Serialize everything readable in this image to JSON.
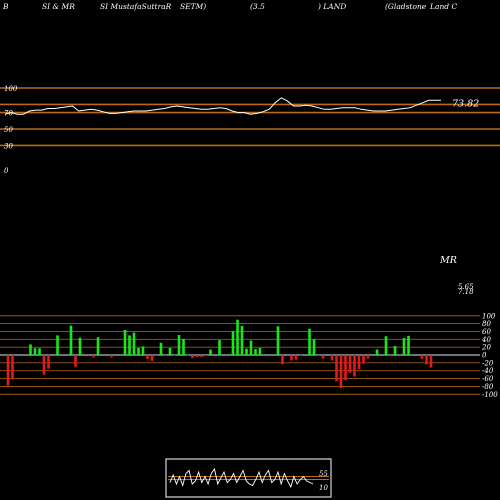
{
  "header": {
    "items": [
      "B",
      "SI & MR",
      "SI MustafaSuttraR",
      "SETM)",
      "(3.5",
      ") LAND",
      "(Gladstone",
      "Land C"
    ]
  },
  "colors": {
    "background": "#000000",
    "guide": "#b86a1a",
    "rsi_line": "#ffffff",
    "positive": "#19e619",
    "negative": "#e61919",
    "grid": "#ffffff"
  },
  "chart_data": [
    {
      "type": "line",
      "name": "RSI",
      "ylim": [
        0,
        100
      ],
      "ytick_labels": [
        "100",
        "70",
        "50",
        "30",
        "0"
      ],
      "guide_levels": [
        100,
        80,
        70,
        50,
        30
      ],
      "last_value_label": "73.82",
      "values": [
        68,
        70,
        68,
        68,
        72,
        73,
        73,
        75,
        75,
        76,
        77,
        78,
        72,
        73,
        74,
        73,
        71,
        69,
        69,
        70,
        71,
        72,
        72,
        72,
        73,
        74,
        75,
        77,
        78,
        77,
        76,
        75,
        74,
        74,
        75,
        76,
        75,
        72,
        70,
        70,
        68,
        69,
        71,
        74,
        82,
        88,
        84,
        78,
        78,
        79,
        78,
        76,
        74,
        74,
        75,
        76,
        76,
        76,
        74,
        73,
        72,
        72,
        72,
        73,
        74,
        75,
        76,
        79,
        82,
        85,
        85,
        85
      ]
    },
    {
      "type": "bar",
      "name": "MR",
      "title": "MR",
      "ylim": [
        -100,
        100
      ],
      "yticks": [
        100,
        80,
        60,
        40,
        20,
        0,
        -20,
        -40,
        -60,
        -80,
        -100
      ],
      "last_value_labels": [
        "5.65",
        "7.18"
      ],
      "values": [
        -78,
        -62,
        0,
        0,
        0,
        27,
        17,
        17,
        -50,
        -35,
        0,
        50,
        0,
        0,
        75,
        -30,
        44,
        0,
        0,
        -6,
        45,
        0,
        0,
        -6,
        0,
        0,
        64,
        50,
        57,
        18,
        22,
        -10,
        -15,
        -2,
        31,
        -2,
        18,
        -2,
        51,
        41,
        -2,
        -8,
        -5,
        -5,
        -2,
        14,
        0,
        38,
        0,
        0,
        60,
        90,
        74,
        16,
        37,
        15,
        18,
        0,
        0,
        0,
        73,
        -24,
        0,
        -14,
        -12,
        -2,
        0,
        67,
        40,
        -2,
        -9,
        0,
        -14,
        -67,
        -84,
        -64,
        -45,
        -55,
        -36,
        -22,
        -9,
        0,
        14,
        0,
        48,
        -3,
        23,
        0,
        43,
        49,
        0,
        0,
        -10,
        -24,
        -32
      ]
    },
    {
      "type": "line",
      "name": "mini",
      "ylim": [
        0,
        100
      ],
      "ytick_labels": [
        "55",
        "10"
      ],
      "values": [
        35,
        60,
        30,
        55,
        25,
        65,
        75,
        30,
        40,
        70,
        35,
        55,
        30,
        65,
        80,
        30,
        50,
        70,
        35,
        45,
        65,
        35,
        55,
        75,
        40,
        30,
        25,
        45,
        70,
        35,
        60,
        75,
        35,
        45,
        70,
        30,
        65,
        40,
        20,
        55,
        30,
        45,
        55,
        40,
        35,
        30
      ]
    }
  ]
}
